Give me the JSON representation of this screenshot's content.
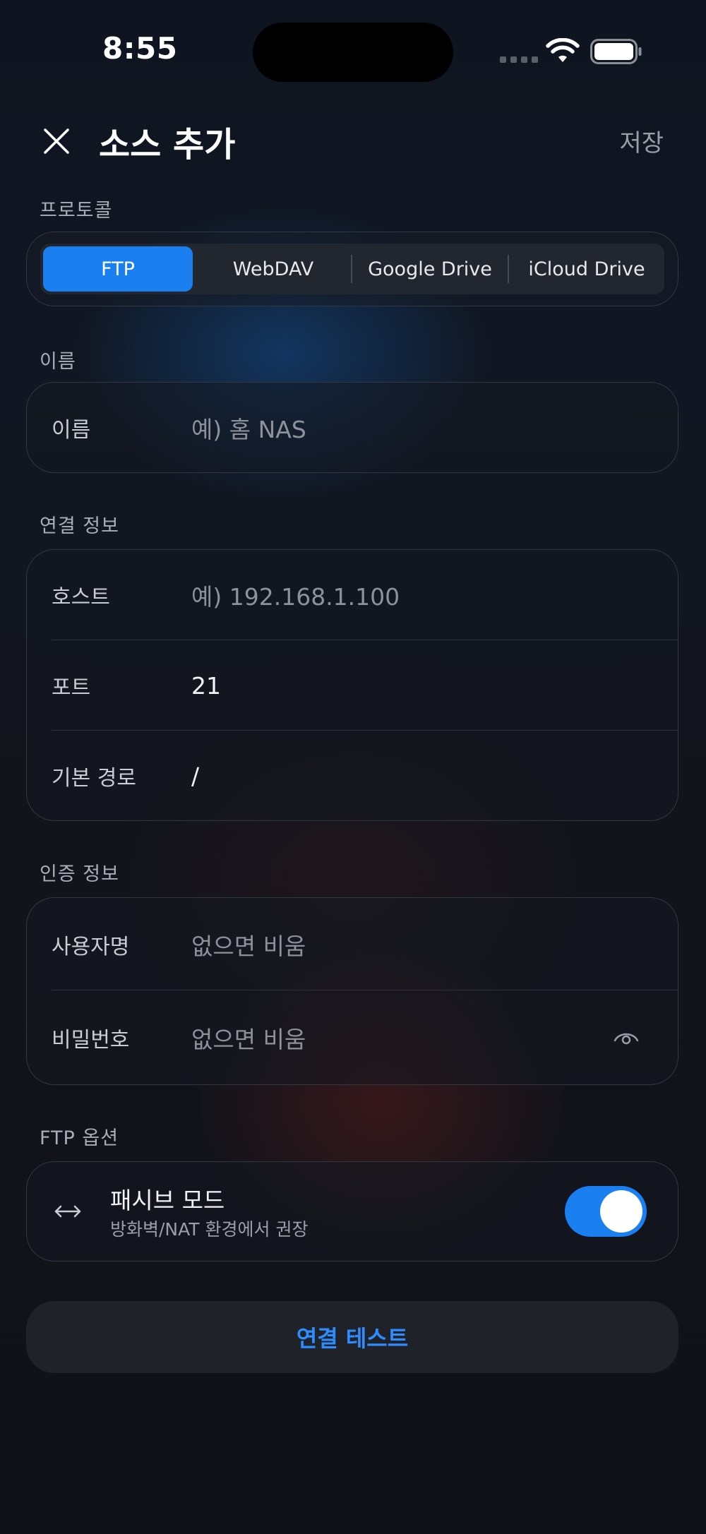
{
  "status_bar": {
    "time": "8:55"
  },
  "header": {
    "close_icon": "close-icon",
    "title": "소스 추가",
    "save_label": "저장"
  },
  "protocol_section": {
    "label": "프로토콜",
    "options": [
      "FTP",
      "WebDAV",
      "Google Drive",
      "iCloud Drive"
    ],
    "selected": "FTP"
  },
  "name_section": {
    "label": "이름",
    "field_label": "이름",
    "placeholder": "예) 홈 NAS"
  },
  "connection_section": {
    "label": "연결 정보",
    "host": {
      "label": "호스트",
      "placeholder": "예) 192.168.1.100"
    },
    "port": {
      "label": "포트",
      "value": "21"
    },
    "base_path": {
      "label": "기본 경로",
      "value": "/"
    }
  },
  "auth_section": {
    "label": "인증 정보",
    "username": {
      "label": "사용자명",
      "placeholder": "없으면 비움"
    },
    "password": {
      "label": "비밀번호",
      "placeholder": "없으면 비움",
      "icon": "eye-icon"
    }
  },
  "ftp_options_section": {
    "label": "FTP 옵션",
    "passive_mode": {
      "icon": "arrows-horizontal-icon",
      "title": "패시브 모드",
      "subtitle": "방화벽/NAT 환경에서 권장",
      "enabled": true
    }
  },
  "test_button": {
    "label": "연결 테스트"
  },
  "colors": {
    "accent": "#1a7ff0",
    "link": "#2f8cff"
  }
}
